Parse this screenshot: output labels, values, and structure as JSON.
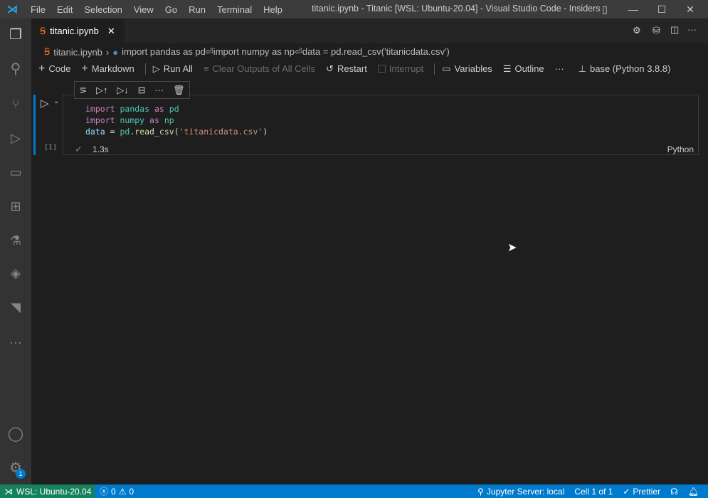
{
  "titlebar": {
    "menus": [
      "File",
      "Edit",
      "Selection",
      "View",
      "Go",
      "Run",
      "Terminal",
      "Help"
    ],
    "title": "titanic.ipynb - Titanic [WSL: Ubuntu-20.04] - Visual Studio Code - Insiders"
  },
  "tab": {
    "label": "titanic.ipynb"
  },
  "breadcrumb": {
    "file": "titanic.ipynb",
    "cell": "import pandas as pd⏎import numpy as np⏎data = pd.read_csv('titanicdata.csv')"
  },
  "toolbar": {
    "code": "Code",
    "markdown": "Markdown",
    "run_all": "Run All",
    "clear": "Clear Outputs of All Cells",
    "restart": "Restart",
    "interrupt": "Interrupt",
    "variables": "Variables",
    "outline": "Outline",
    "more": "···",
    "kernel": "base (Python 3.8.8)"
  },
  "cell": {
    "exec_count": "[1]",
    "time": "1.3s",
    "language": "Python",
    "lines": [
      [
        "import",
        "pandas",
        "as",
        "pd"
      ],
      [
        "import",
        "numpy",
        "as",
        "np"
      ]
    ],
    "line3": {
      "var": "data",
      "eq": " = ",
      "obj": "pd",
      "dot": ".",
      "fn": "read_csv",
      "open": "(",
      "str": "'titanicdata.csv'",
      "close": ")"
    }
  },
  "status": {
    "remote": "WSL: Ubuntu-20.04",
    "errors": "0",
    "warnings": "0",
    "jupyter": "Jupyter Server: local",
    "cell": "Cell 1 of 1",
    "prettier": "Prettier"
  },
  "badges": {
    "settings": "1"
  },
  "colors": {
    "accent": "#007acc",
    "remote": "#16825d"
  }
}
